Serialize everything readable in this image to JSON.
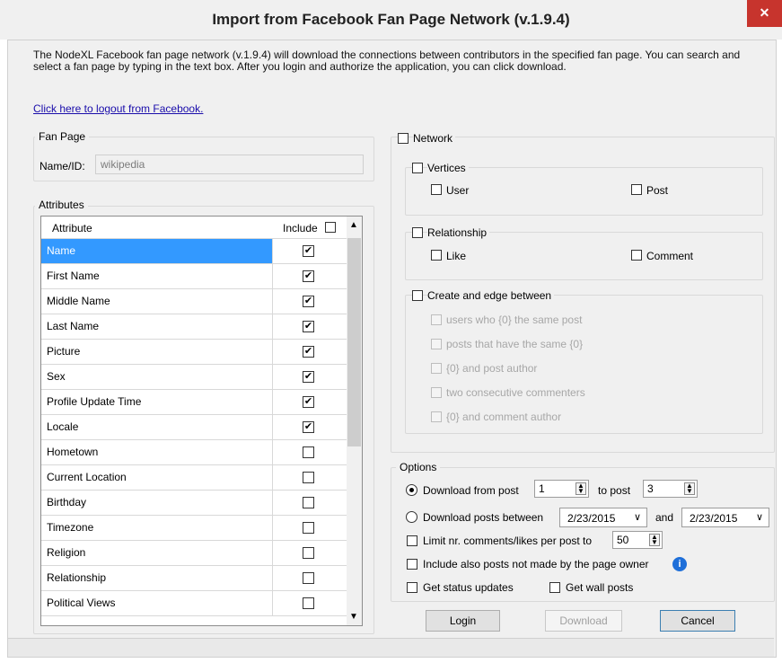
{
  "window": {
    "title": "Import from Facebook Fan Page Network (v.1.9.4)",
    "close_glyph": "✕"
  },
  "description": "The NodeXL Facebook fan page network (v.1.9.4) will download the connections between contributors in the specified fan page. You can search and select a fan page by typing in the text box. After you login and authorize the application, you can click download.",
  "logout_link": "Click here to logout from Facebook.",
  "fan_page": {
    "legend": "Fan Page",
    "name_label": "Name/ID:",
    "name_value": "wikipedia"
  },
  "attributes": {
    "legend": "Attributes",
    "col_attribute": "Attribute",
    "col_include": "Include",
    "rows": [
      {
        "name": "Name",
        "checked": true,
        "selected": true
      },
      {
        "name": "First Name",
        "checked": true
      },
      {
        "name": "Middle Name",
        "checked": true
      },
      {
        "name": "Last Name",
        "checked": true
      },
      {
        "name": "Picture",
        "checked": true
      },
      {
        "name": "Sex",
        "checked": true
      },
      {
        "name": "Profile Update Time",
        "checked": true
      },
      {
        "name": "Locale",
        "checked": true
      },
      {
        "name": "Hometown",
        "checked": false
      },
      {
        "name": "Current Location",
        "checked": false
      },
      {
        "name": "Birthday",
        "checked": false
      },
      {
        "name": "Timezone",
        "checked": false
      },
      {
        "name": "Religion",
        "checked": false
      },
      {
        "name": "Relationship",
        "checked": false
      },
      {
        "name": "Political Views",
        "checked": false
      }
    ]
  },
  "network": {
    "label": "Network",
    "vertices": {
      "label": "Vertices",
      "user": "User",
      "post": "Post"
    },
    "relationship": {
      "label": "Relationship",
      "like": "Like",
      "comment": "Comment"
    },
    "edge": {
      "label": "Create and edge between",
      "options": [
        "users who {0} the same post",
        "posts that have the same {0}",
        "{0} and post author",
        "two consecutive commenters",
        "{0} and comment author"
      ]
    }
  },
  "options": {
    "legend": "Options",
    "download_from_post": "Download from post",
    "from_value": "1",
    "to_post": "to post",
    "to_value": "3",
    "download_between": "Download posts between",
    "date_from": "2/23/2015",
    "and_label": "and",
    "date_to": "2/23/2015",
    "limit_label": "Limit nr. comments/likes per post to",
    "limit_value": "50",
    "include_label": "Include also posts not made by the page owner",
    "status_label": "Get status updates",
    "wall_label": "Get wall posts"
  },
  "buttons": {
    "login": "Login",
    "download": "Download",
    "cancel": "Cancel"
  }
}
